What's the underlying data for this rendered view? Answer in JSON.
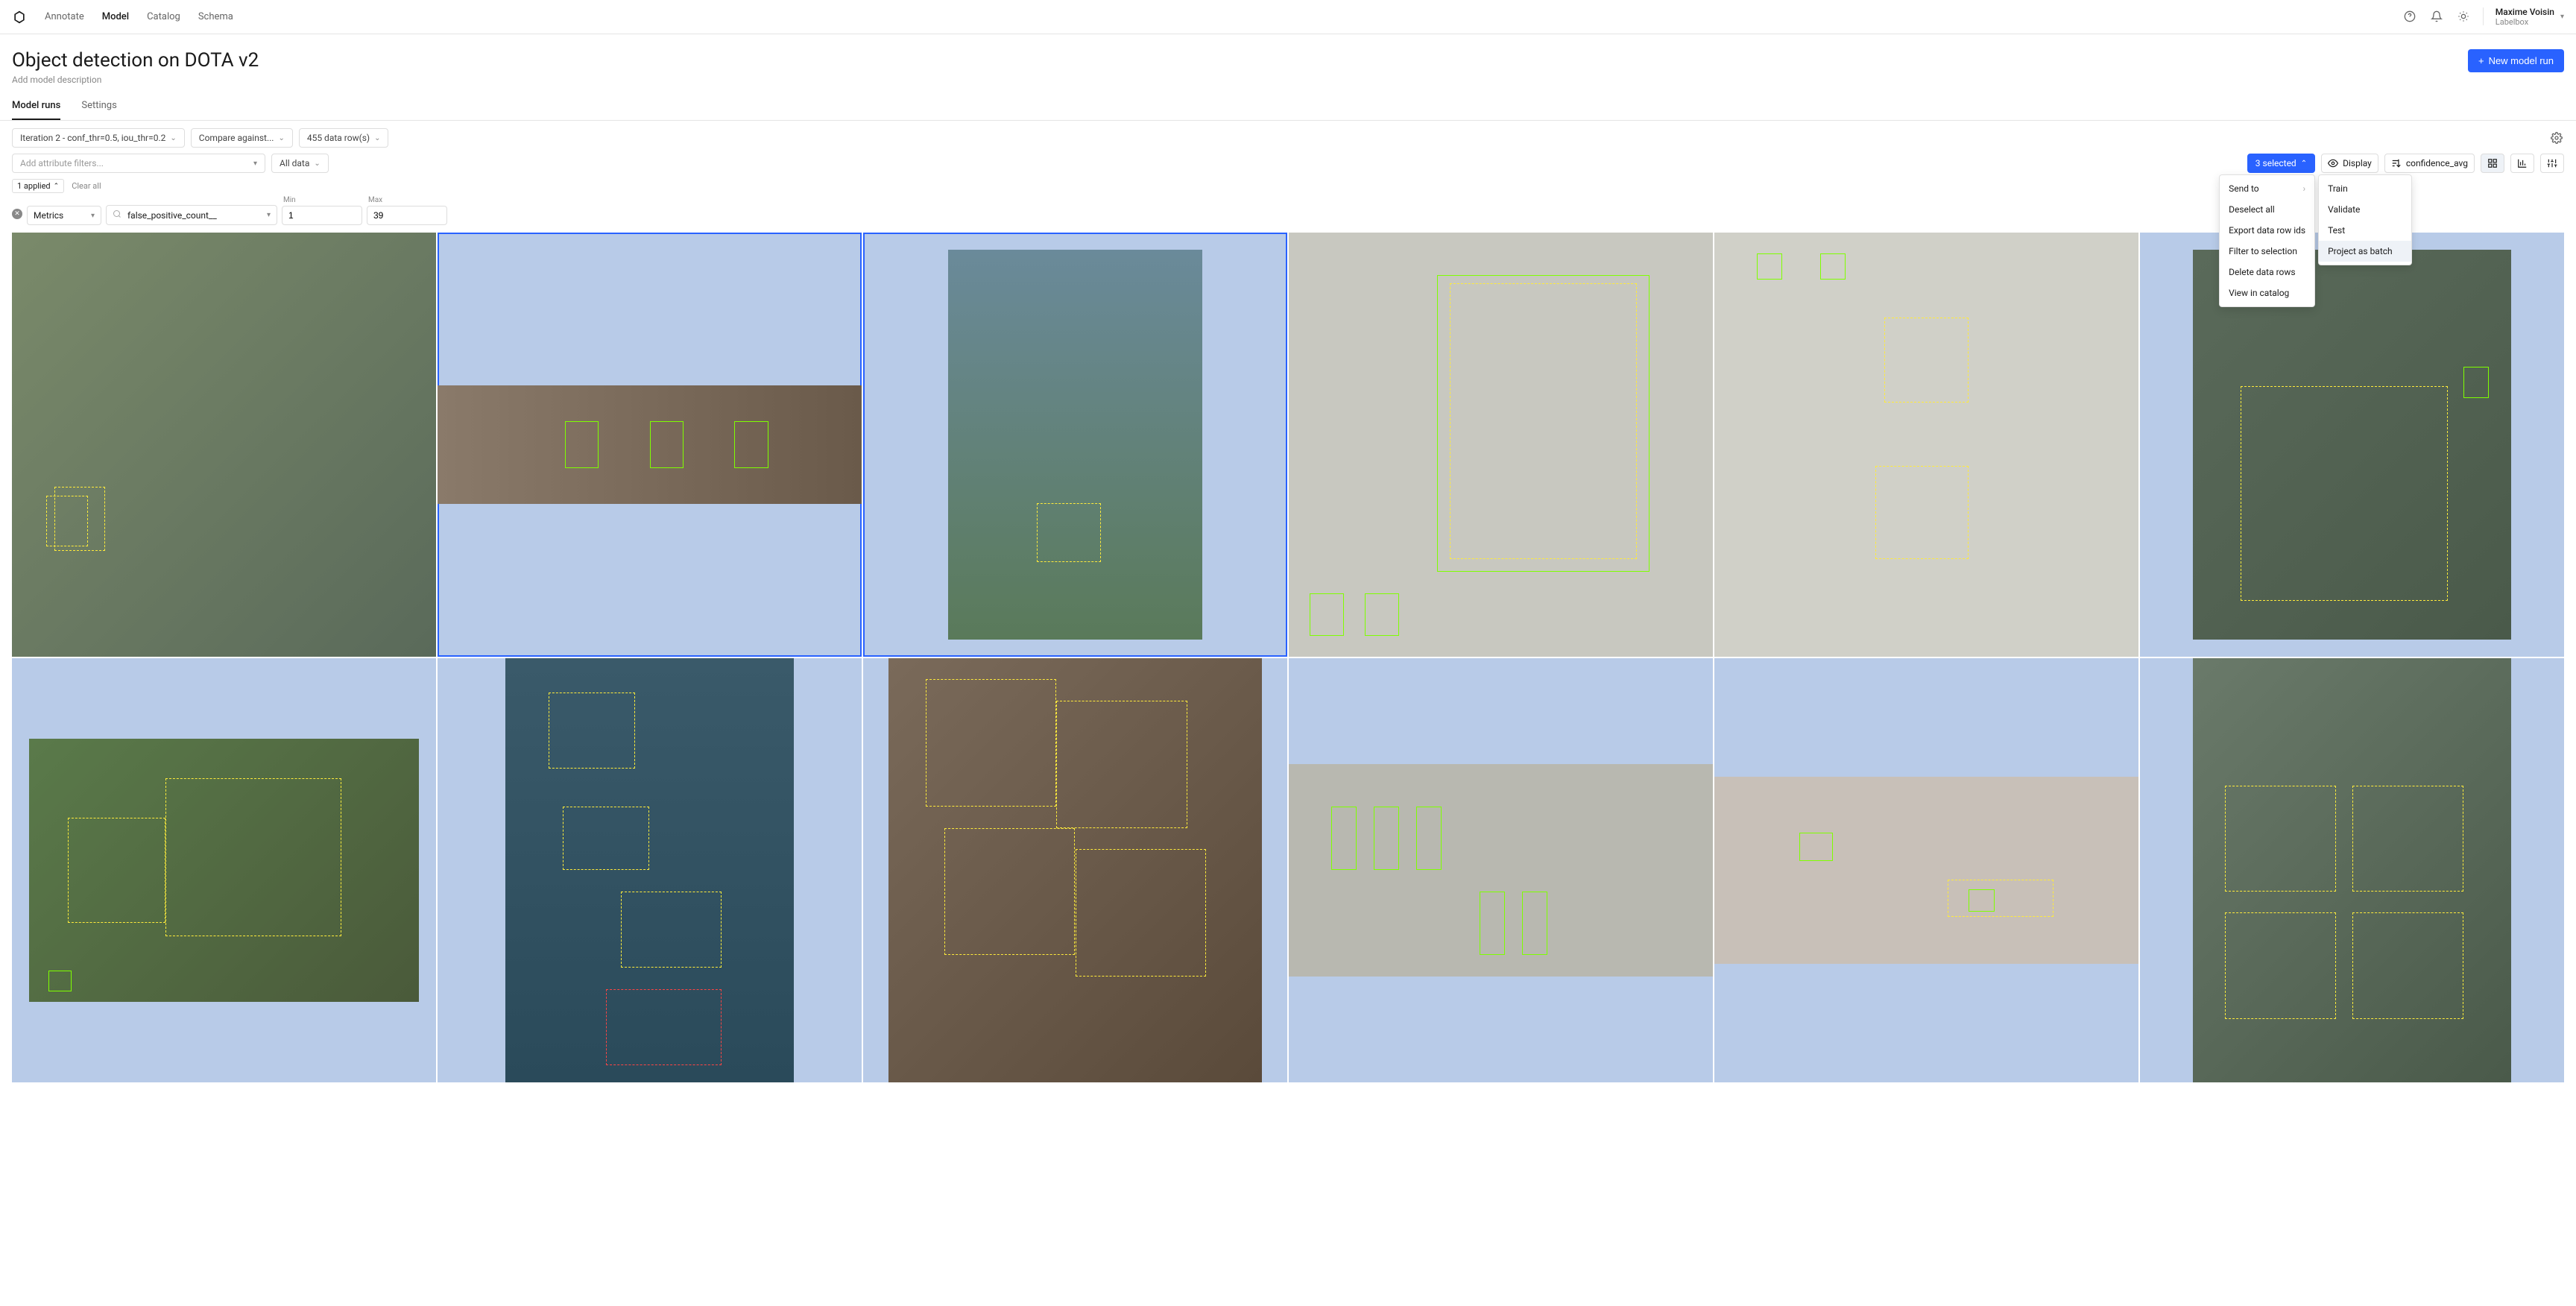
{
  "nav": {
    "items": [
      "Annotate",
      "Model",
      "Catalog",
      "Schema"
    ],
    "active": 1
  },
  "user": {
    "name": "Maxime Voisin",
    "org": "Labelbox"
  },
  "page": {
    "title": "Object detection on DOTA v2",
    "desc": "Add model description"
  },
  "button": {
    "new_run": "New model run"
  },
  "tabs": {
    "items": [
      "Model runs",
      "Settings"
    ],
    "active": 0
  },
  "filters": {
    "iteration": "Iteration 2 - conf_thr=0.5, iou_thr=0.2",
    "compare": "Compare against...",
    "rows": "455 data row(s)",
    "add_attr_placeholder": "Add attribute filters...",
    "all_data": "All data",
    "applied_count": "1 applied",
    "clear_all": "Clear all",
    "metrics_label": "Metrics",
    "attr": "false_positive_count__",
    "min_label": "Min",
    "min_value": "1",
    "max_label": "Max",
    "max_value": "39"
  },
  "right_controls": {
    "selected": "3 selected",
    "display": "Display",
    "sort": "confidence_avg"
  },
  "menu1": [
    "Send to",
    "Deselect all",
    "Export data row ids",
    "Filter to selection",
    "Delete data rows",
    "View in catalog"
  ],
  "menu2": [
    "Train",
    "Validate",
    "Test",
    "Project as batch"
  ],
  "menu2_hover": 3
}
